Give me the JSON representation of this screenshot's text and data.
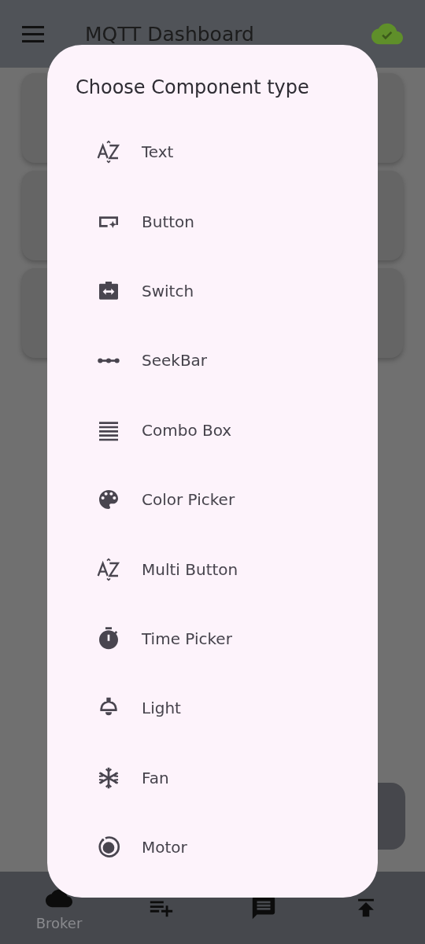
{
  "app_bar": {
    "title": "MQTT Dashboard",
    "connected": true
  },
  "bottom_nav": [
    {
      "kind": "broker",
      "label": "Broker"
    },
    {
      "kind": "add-list"
    },
    {
      "kind": "messages"
    },
    {
      "kind": "publish"
    }
  ],
  "dialog": {
    "title": "Choose Component type",
    "options": [
      {
        "kind": "text",
        "label": "Text"
      },
      {
        "kind": "button",
        "label": "Button"
      },
      {
        "kind": "switch",
        "label": "Switch"
      },
      {
        "kind": "seekbar",
        "label": "SeekBar"
      },
      {
        "kind": "combo",
        "label": "Combo Box"
      },
      {
        "kind": "color",
        "label": "Color Picker"
      },
      {
        "kind": "multi",
        "label": "Multi Button"
      },
      {
        "kind": "time",
        "label": "Time Picker"
      },
      {
        "kind": "light",
        "label": "Light"
      },
      {
        "kind": "fan",
        "label": "Fan"
      },
      {
        "kind": "motor",
        "label": "Motor"
      }
    ]
  }
}
